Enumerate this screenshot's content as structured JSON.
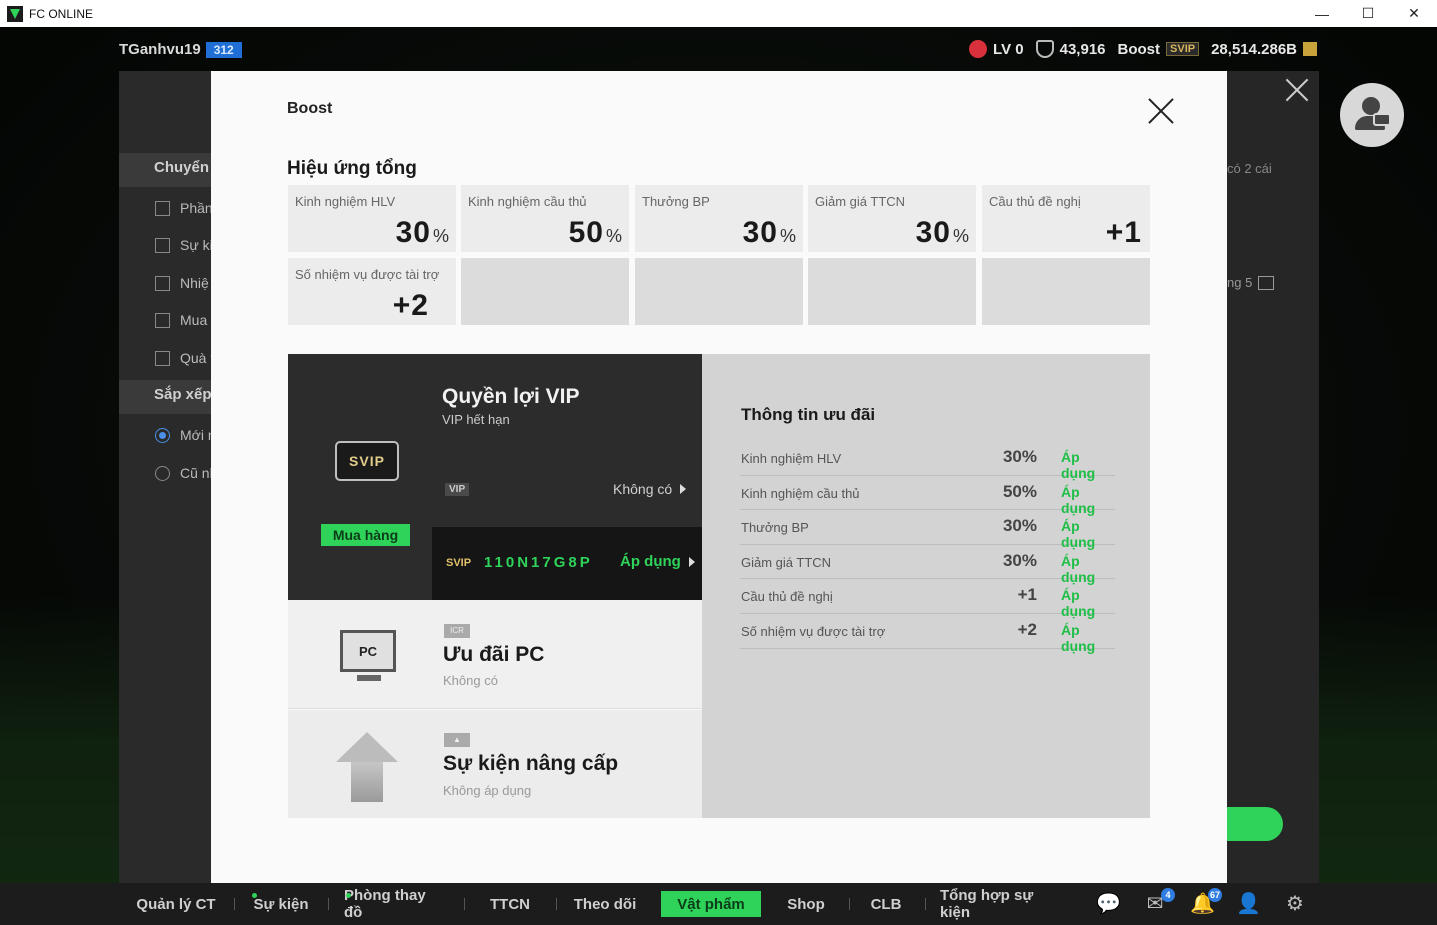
{
  "window": {
    "title": "FC ONLINE",
    "controls": [
      "—",
      "☐",
      "✕"
    ]
  },
  "hud": {
    "username": "TGanhvu19",
    "level": "312",
    "lv": "LV 0",
    "points": "43,916",
    "boost_label": "Boost",
    "svip": "SVIP",
    "balance": "28,514.286B"
  },
  "side_panel": {
    "header1": "Chuyển đổi",
    "filters": [
      "Phần",
      "Sự ki",
      "Nhiệ",
      "Mua",
      "Quà t"
    ],
    "header2": "Sắp xếp",
    "sort": [
      "Mới n",
      "Cũ nh"
    ]
  },
  "right_panel": {
    "count_text": "có   2 cái",
    "date_text": "ng 5"
  },
  "modal": {
    "title": "Boost",
    "section_title": "Hiệu ứng tổng",
    "effects": [
      {
        "label": "Kinh nghiệm HLV",
        "value": "30",
        "unit": "%"
      },
      {
        "label": "Kinh nghiệm cầu thủ",
        "value": "50",
        "unit": "%"
      },
      {
        "label": "Thưởng BP",
        "value": "30",
        "unit": "%"
      },
      {
        "label": "Giảm giá TTCN",
        "value": "30",
        "unit": "%"
      },
      {
        "label": "Cầu thủ đề nghị",
        "value": "+1",
        "unit": ""
      },
      {
        "label": "Số nhiệm vụ được tài trợ",
        "value": "+2",
        "unit": ""
      }
    ],
    "vip": {
      "logo": "SVIP",
      "buy_label": "Mua hàng",
      "title": "Quyền lợi VIP",
      "subtitle": "VIP hết hạn",
      "tag": "VIP",
      "none_label": "Không có",
      "code_tag": "SVIP",
      "code": "110N17G8P",
      "apply_label": "Áp dụng"
    },
    "pc": {
      "icon_text": "PC",
      "tag": "ICR",
      "title": "Ưu đãi PC",
      "subtitle": "Không có"
    },
    "upgrade": {
      "tag": "",
      "title": "Sự kiện nâng cấp",
      "subtitle": "Không áp dụng"
    },
    "info": {
      "title": "Thông tin ưu đãi",
      "rows": [
        {
          "label": "Kinh nghiệm HLV",
          "value": "30%",
          "status": "Áp dụng"
        },
        {
          "label": "Kinh nghiệm cầu thủ",
          "value": "50%",
          "status": "Áp dụng"
        },
        {
          "label": "Thưởng BP",
          "value": "30%",
          "status": "Áp dụng"
        },
        {
          "label": "Giảm giá TTCN",
          "value": "30%",
          "status": "Áp dụng"
        },
        {
          "label": "Cầu thủ đề nghị",
          "value": "+1",
          "status": "Áp dụng"
        },
        {
          "label": "Số nhiệm vụ được tài trợ",
          "value": "+2",
          "status": "Áp dụng"
        }
      ]
    }
  },
  "bottom_nav": {
    "items": [
      "Quản lý CT",
      "Sự kiện",
      "Phòng thay đồ",
      "TTCN",
      "Theo dõi",
      "Vật phẩm",
      "Shop",
      "CLB",
      "Tổng hợp sự kiện"
    ],
    "active": "Vật phẩm",
    "mail_badge": "4",
    "notif_badge": "67"
  },
  "colors": {
    "accent_green": "#2fd35a",
    "level_blue": "#1f6fd6",
    "svip_gold": "#e0c068"
  }
}
